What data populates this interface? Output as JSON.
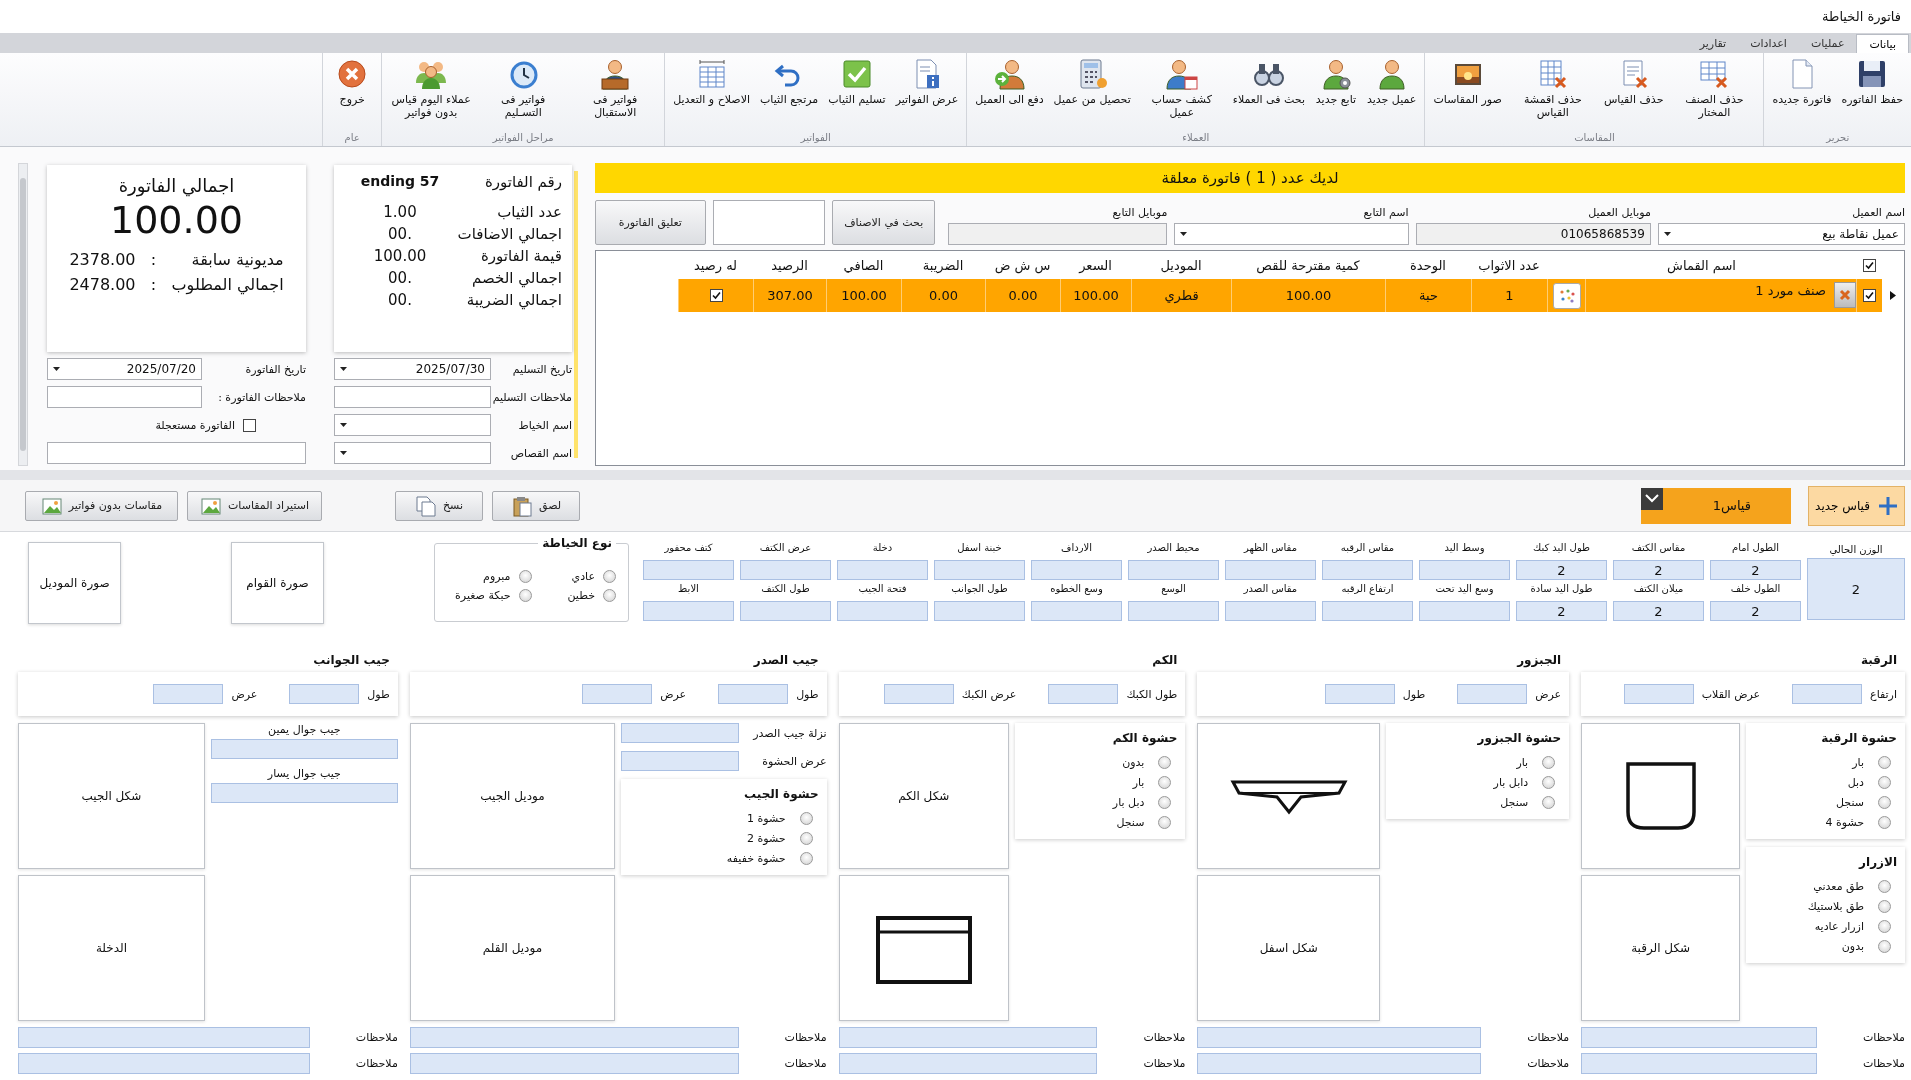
{
  "window": {
    "title": "فاتورة الخياطة"
  },
  "tabs": [
    {
      "label": "بيانات",
      "selected": true
    },
    {
      "label": "عمليات",
      "selected": false
    },
    {
      "label": "اعدادات",
      "selected": false
    },
    {
      "label": "تقارير",
      "selected": false
    }
  ],
  "ribbon": [
    {
      "title": "تحرير",
      "buttons": [
        "حفظ الفاتوره",
        "فاتورة جديده"
      ]
    },
    {
      "title": "المقاسات",
      "buttons": [
        "حذف الصنف المختار",
        "حذف القياس",
        "حذف اقمشة القياس",
        "صور المقاسات"
      ]
    },
    {
      "title": "العملاء",
      "buttons": [
        "عميل جديد",
        "تابع جديد",
        "بحث فى العملاء",
        "كشف حساب عميل",
        "تحصيل من عميل",
        "دفع الى العميل"
      ]
    },
    {
      "title": "الفواتير",
      "buttons": [
        "عرض الفواتير",
        "تسليم الثياب",
        "مرتجع الثياب",
        "الاصلاح و التعديل"
      ]
    },
    {
      "title": "مراحل الفواتير",
      "buttons": [
        "فواتير فى الاستقبال",
        "فواتير فى التسـليم",
        "عملاء اليوم قياس بدون فواتير"
      ]
    },
    {
      "title": "عام",
      "buttons": [
        "خروج"
      ]
    }
  ],
  "invoice": {
    "banner": "لديك عدد ( 1 ) فاتورة معلقة",
    "customer_fields": [
      {
        "label": "اسم العميل",
        "value": "عميل نقاطة بيع",
        "kind": "dropdown",
        "disabled": false
      },
      {
        "label": "موبايل العميل",
        "value": "01065868539",
        "kind": "text",
        "disabled": true
      },
      {
        "label": "اسم التابع",
        "kind": "dropdown",
        "disabled": false
      },
      {
        "label": "موبايل التابع",
        "kind": "text",
        "disabled": true
      }
    ],
    "search_button": "بحث في الاصناف",
    "suspend_button": "تعليق الفاتورة",
    "items": {
      "all_checked": true,
      "columns": [
        "اسم القماش",
        "عدد الاثواب",
        "الوحدة",
        "كمية مقترحة للقص",
        "الموديل",
        "السعر",
        "س ش ض",
        "الضريبة",
        "الصافي",
        "الرصيد",
        "له رصيد"
      ],
      "rows": [
        {
          "selected": true,
          "checked": true,
          "cells": [
            "صنف مورد 1",
            "1",
            "حبة",
            "100.00",
            "قطري",
            "100.00",
            "0.00",
            "0.00",
            "100.00",
            "307.00"
          ],
          "has_balance": true
        }
      ]
    }
  },
  "summary": {
    "number_label": "رقم الفاتورة",
    "number": "ending 57",
    "stats": [
      {
        "label": "عدد الثياب",
        "value": "1.00"
      },
      {
        "label": "اجمالي الاضافات",
        "value": "00."
      },
      {
        "label": "قيمة الفاتورة",
        "value": "100.00"
      },
      {
        "label": "اجمالي الخصم",
        "value": "00."
      },
      {
        "label": "اجمالي الضريبة",
        "value": "00."
      }
    ],
    "total_title": "اجمالي الفاتورة",
    "total": "100.00",
    "balances": [
      {
        "label": "مديونية سابقة",
        "sep": ":",
        "value": "2378.00"
      },
      {
        "label": "اجمالي المطلوب",
        "sep": ":",
        "value": "2478.00"
      }
    ]
  },
  "invoice_form": {
    "delivery_date": {
      "label": "تاريخ التسليم",
      "value": "2025/07/30"
    },
    "invoice_date": {
      "label": "تاريخ الفاتورة",
      "value": "2025/07/20"
    },
    "delivery_notes": {
      "label": "ملاحظات التسليم"
    },
    "invoice_notes": {
      "label": "ملاحظات الفاتورة",
      "sep": ":"
    },
    "tailor": {
      "label": "اسم الخياط"
    },
    "urgent": {
      "label": "الفاتورة مستعجلة",
      "checked": false
    },
    "cutter": {
      "label": "اسم القصاص"
    }
  },
  "measure_toolbar": {
    "new_button": "قياس جديد",
    "tabs": [
      {
        "label": "قياس1",
        "selected": true
      }
    ],
    "buttons": [
      "لصق",
      "نسخ",
      "استيراد المقاسات",
      "مقاسات بدون فواتير"
    ]
  },
  "measurements": {
    "weight": {
      "label": "الوزن الحالي",
      "value": "2"
    },
    "rows": [
      [
        {
          "label": "الطول امام",
          "value": "2"
        },
        {
          "label": "مقاس الكتف",
          "value": "2"
        },
        {
          "label": "طول اليد كبك",
          "value": "2"
        },
        {
          "label": "وسط اليد"
        },
        {
          "label": "مقاس الرقبه"
        },
        {
          "label": "مقاس الظهر"
        },
        {
          "label": "محيط الصدر"
        },
        {
          "label": "الارداف"
        },
        {
          "label": "خبنة اسفل"
        },
        {
          "label": "دخلة"
        },
        {
          "label": "عرض الكتف"
        },
        {
          "label": "كتف محفور"
        }
      ],
      [
        {
          "label": "الطول خلف",
          "value": "2"
        },
        {
          "label": "ميلان الكتف",
          "value": "2"
        },
        {
          "label": "طول اليد سادة",
          "value": "2"
        },
        {
          "label": "وسع اليد تحت"
        },
        {
          "label": "ارتفاع الرقبه"
        },
        {
          "label": "مقاس الصدر"
        },
        {
          "label": "الوسع"
        },
        {
          "label": "وسع الخطوه"
        },
        {
          "label": "طول الجوانب"
        },
        {
          "label": "فتحة الجيب"
        },
        {
          "label": "طول الكتف"
        },
        {
          "label": "الابط"
        }
      ]
    ],
    "sewing_type": {
      "title": "نوع الخياطة",
      "options": [
        {
          "label": "عادي",
          "selected": false
        },
        {
          "label": "مبروم",
          "selected": false
        },
        {
          "label": "خطين",
          "selected": false
        },
        {
          "label": "حبكة صغيرة",
          "selected": false
        }
      ]
    },
    "pictures": [
      "صورة القوام",
      "صورة الموديل"
    ]
  },
  "sections": [
    {
      "title": "الرقبة",
      "fields": [
        {
          "label": "ارتفاع"
        },
        {
          "label": "عرض القلاب"
        }
      ],
      "side": [
        {
          "kind": "options",
          "title": "حشوة الرقبة",
          "options": [
            {
              "label": "بار",
              "selected": false
            },
            {
              "label": "دبل",
              "selected": false
            },
            {
              "label": "سنجل",
              "selected": false
            },
            {
              "label": "حشوة 4",
              "selected": false
            }
          ]
        },
        {
          "kind": "options",
          "title": "الازرار",
          "options": [
            {
              "label": "طق معدني",
              "selected": false
            },
            {
              "label": "طق بلاستيك",
              "selected": false
            },
            {
              "label": "ازرار عاديه",
              "selected": false
            },
            {
              "label": "بدون",
              "selected": false
            }
          ]
        }
      ],
      "boxes": [
        {
          "kind": "collar"
        },
        {
          "kind": "label",
          "label": "شكل الرقبة"
        }
      ],
      "notes": [
        "ملاحظات",
        "ملاحظات"
      ]
    },
    {
      "title": "الجبزور",
      "fields": [
        {
          "label": "عرض"
        },
        {
          "label": "طول"
        }
      ],
      "side": [
        {
          "kind": "options",
          "title": "حشوة الجبزور",
          "options": [
            {
              "label": "بار",
              "selected": false
            },
            {
              "label": "دابل بار",
              "selected": false
            },
            {
              "label": "سنجل",
              "selected": false
            }
          ]
        }
      ],
      "boxes": [
        {
          "kind": "band"
        },
        {
          "kind": "label",
          "label": "شكل اسفل"
        }
      ],
      "notes": [
        "ملاحظات",
        "ملاحظات"
      ]
    },
    {
      "title": "الكم",
      "fields": [
        {
          "label": "طول الكبك"
        },
        {
          "label": "عرض الكبك"
        }
      ],
      "side": [
        {
          "kind": "options",
          "title": "حشوة الكم",
          "options": [
            {
              "label": "بدون",
              "selected": false
            },
            {
              "label": "بار",
              "selected": false
            },
            {
              "label": "دبل بار",
              "selected": false
            },
            {
              "label": "سنجل",
              "selected": false
            }
          ]
        }
      ],
      "boxes": [
        {
          "kind": "label",
          "label": "شكل الكم"
        },
        {
          "kind": "cuff"
        }
      ],
      "notes": [
        "ملاحظات",
        "ملاحظات"
      ]
    },
    {
      "title": "جيب الصدر",
      "fields": [
        {
          "label": "طول"
        },
        {
          "label": "عرض"
        }
      ],
      "side": [
        {
          "kind": "inline",
          "label": "نزلة جيب الصدر"
        },
        {
          "kind": "inline",
          "label": "عرض الحشوة"
        },
        {
          "kind": "options",
          "title": "حشوة الجيب",
          "options": [
            {
              "label": "حشوة 1",
              "selected": false
            },
            {
              "label": "حشوة 2",
              "selected": false
            },
            {
              "label": "حشوة خفيفه",
              "selected": false
            }
          ]
        }
      ],
      "boxes": [
        {
          "kind": "label",
          "label": "موديل الجيب"
        },
        {
          "kind": "label",
          "label": "موديل القلم"
        }
      ],
      "notes": [
        "ملاحظات",
        "ملاحظات"
      ]
    },
    {
      "title": "جيب الجوانب",
      "fields": [
        {
          "label": "طول"
        },
        {
          "label": "عرض"
        }
      ],
      "side": [
        {
          "kind": "stacked",
          "label": "جيب جوال يمين"
        },
        {
          "kind": "stacked",
          "label": "جيب جوال يسار"
        }
      ],
      "boxes": [
        {
          "kind": "label",
          "label": "شكل الجيب"
        },
        {
          "kind": "label",
          "label": "الدخلة"
        }
      ],
      "notes": [
        "ملاحظات",
        "ملاحظات"
      ]
    }
  ]
}
